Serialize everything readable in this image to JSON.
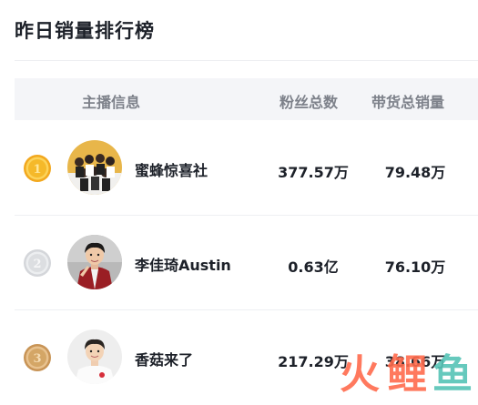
{
  "title": "昨日销量排行榜",
  "table": {
    "headers": {
      "anchor_info": "主播信息",
      "fans_total": "粉丝总数",
      "sales_total": "带货总销量"
    },
    "rows": [
      {
        "rank": "1",
        "medal": "gold-medal-icon",
        "name": "蜜蜂惊喜社",
        "fans": "377.57万",
        "sales": "79.48万"
      },
      {
        "rank": "2",
        "medal": "silver-medal-icon",
        "name": "李佳琦Austin",
        "fans": "0.63亿",
        "sales": "76.10万"
      },
      {
        "rank": "3",
        "medal": "bronze-medal-icon",
        "name": "香菇来了",
        "fans": "217.29万",
        "sales": "38.66万"
      }
    ]
  },
  "colors": {
    "gold": "#f5b92a",
    "silver": "#c9cbcf",
    "bronze": "#d4a666",
    "header_bg": "#f4f5f8",
    "header_text": "#7d818a",
    "watermark_fire": "#ff6a4d",
    "watermark_fish": "#55c3b6"
  },
  "watermark": {
    "icon": "huoli-fish-logo",
    "chars": [
      "火",
      "鲤",
      "鱼"
    ]
  }
}
